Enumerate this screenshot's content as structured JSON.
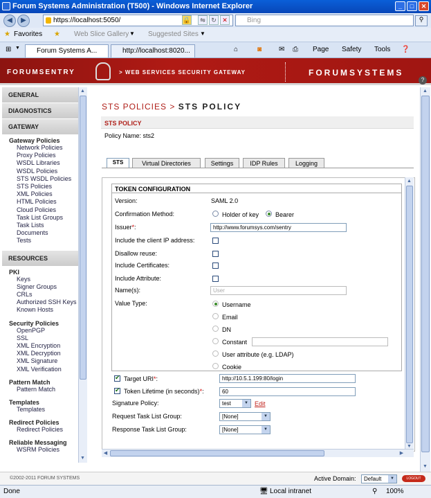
{
  "window": {
    "title": "Forum Systems Administration (T500) - Windows Internet Explorer"
  },
  "browser": {
    "url": "https://localhost:5050/",
    "search_placeholder": "Bing",
    "favorites": {
      "label": "Favorites",
      "web_slice": "Web Slice Gallery",
      "suggested": "Suggested Sites"
    },
    "tabs": [
      {
        "label": "Forum Systems A..."
      },
      {
        "label": "http://localhost:8020..."
      }
    ],
    "commands": {
      "page": "Page",
      "safety": "Safety",
      "tools": "Tools"
    }
  },
  "banner": {
    "logo": "FORUMSENTRY",
    "subtitle": "> WEB SERVICES SECURITY GATEWAY",
    "brand": "FORUMSYSTEMS",
    "help": "?"
  },
  "sidebar": {
    "general": "GENERAL",
    "diagnostics": "DIAGNOSTICS",
    "gateway": "GATEWAY",
    "gateway_policies": "Gateway Policies",
    "gateway_items": [
      "Network Policies",
      "Proxy Policies",
      "WSDL Libraries",
      "WSDL Policies",
      "STS WSDL Policies",
      "STS Policies",
      "XML Policies",
      "HTML Policies",
      "Cloud Policies",
      "Task List Groups",
      "Task Lists",
      "Documents",
      "Tests"
    ],
    "resources": "RESOURCES",
    "pki": "PKI",
    "pki_items": [
      "Keys",
      "Signer Groups",
      "CRLs",
      "Authorized SSH Keys",
      "Known Hosts"
    ],
    "security_policies": "Security Policies",
    "security_items": [
      "OpenPGP",
      "SSL",
      "XML Encryption",
      "XML Decryption",
      "XML Signature",
      "XML Verification"
    ],
    "pattern_match": "Pattern Match",
    "pattern_items": [
      "Pattern Match"
    ],
    "templates": "Templates",
    "templates_items": [
      "Templates"
    ],
    "redirect": "Redirect Policies",
    "redirect_items": [
      "Redirect Policies"
    ],
    "reliable": "Reliable Messaging",
    "reliable_items": [
      "WSRM Policies"
    ]
  },
  "breadcrumb": {
    "parent": "STS POLICIES",
    "sep": ">",
    "current": "STS POLICY"
  },
  "policy": {
    "header": "STS POLICY",
    "name_label": "Policy Name:",
    "name": "sts2"
  },
  "tabs": [
    "STS",
    "Virtual Directories",
    "Settings",
    "IDP Rules",
    "Logging"
  ],
  "token": {
    "header": "TOKEN CONFIGURATION",
    "version_label": "Version:",
    "version": "SAML 2.0",
    "confirmation_label": "Confirmation Method:",
    "confirmation_options": [
      "Holder of key",
      "Bearer"
    ],
    "confirmation_selected": "Bearer",
    "issuer_label": "Issuer",
    "issuer": "http://www.forumsys.com/sentry",
    "client_ip_label": "Include the client IP address:",
    "disallow_reuse_label": "Disallow reuse:",
    "include_certs_label": "Include Certificates:",
    "include_attr_label": "Include Attribute:",
    "names_label": "Name(s):",
    "names_placeholder": "User",
    "value_type_label": "Value Type:",
    "value_types": [
      "Username",
      "Email",
      "DN",
      "Constant",
      "User attribute (e.g. LDAP)",
      "Cookie"
    ]
  },
  "target_uri": {
    "label": "Target URI",
    "value": "http://10.5.1.199:80/login"
  },
  "token_lifetime": {
    "label": "Token Lifetime (in seconds)",
    "value": "60"
  },
  "signature_policy": {
    "label": "Signature Policy:",
    "value": "test",
    "edit": "Edit"
  },
  "request_tlg": {
    "label": "Request Task List Group:",
    "value": "[None]"
  },
  "response_tlg": {
    "label": "Response Task List Group:",
    "value": "[None]"
  },
  "required_mark": "*",
  "footer": {
    "copyright": "©2002-2011 FORUM SYSTEMS",
    "domain_label": "Active Domain:",
    "domain": "Default",
    "logout": "LOGOUT"
  },
  "status": {
    "left": "Done",
    "zone": "Local intranet",
    "zoom": "100%"
  }
}
